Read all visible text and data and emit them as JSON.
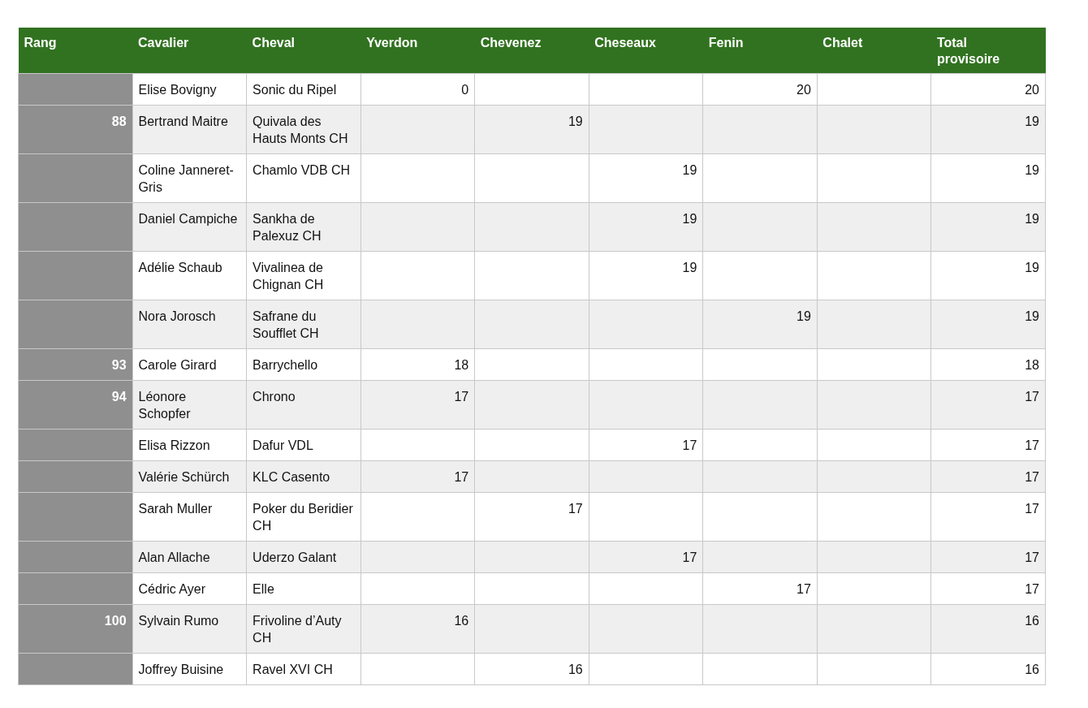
{
  "table": {
    "columns": [
      "Rang",
      "Cavalier",
      "Cheval",
      "Yverdon",
      "Chevenez",
      "Cheseaux",
      "Fenin",
      "Chalet",
      "Total provisoire"
    ],
    "rows": [
      {
        "rider": "Elise Bovigny",
        "horse": "Sonic du Ripel",
        "yverdon": "0",
        "fenin": "20",
        "total": "20"
      },
      {
        "rank": "88",
        "rider": "Bertrand Maitre",
        "horse": "Quivala des Hauts Monts CH",
        "chevenez": "19",
        "total": "19"
      },
      {
        "rider": "Coline Janneret-Gris",
        "horse": "Chamlo VDB CH",
        "cheseaux": "19",
        "total": "19"
      },
      {
        "rider": "Daniel Campiche",
        "horse": "Sankha de Palexuz CH",
        "cheseaux": "19",
        "total": "19"
      },
      {
        "rider": "Adélie Schaub",
        "horse": "Vivalinea de Chignan CH",
        "cheseaux": "19",
        "total": "19"
      },
      {
        "rider": "Nora Jorosch",
        "horse": "Safrane du Soufflet CH",
        "fenin": "19",
        "total": "19"
      },
      {
        "rank": "93",
        "rider": "Carole Girard",
        "horse": "Barrychello",
        "yverdon": "18",
        "total": "18"
      },
      {
        "rank": "94",
        "rider": "Léonore Schopfer",
        "horse": "Chrono",
        "yverdon": "17",
        "total": "17"
      },
      {
        "rider": "Elisa Rizzon",
        "horse": "Dafur VDL",
        "cheseaux": "17",
        "total": "17"
      },
      {
        "rider": "Valérie Schürch",
        "horse": "KLC Casento",
        "yverdon": "17",
        "total": "17"
      },
      {
        "rider": "Sarah Muller",
        "horse": "Poker du Beridier CH",
        "chevenez": "17",
        "total": "17"
      },
      {
        "rider": "Alan Allache",
        "horse": "Uderzo Galant",
        "cheseaux": "17",
        "total": "17"
      },
      {
        "rider": "Cédric Ayer",
        "horse": "Elle",
        "fenin": "17",
        "total": "17"
      },
      {
        "rank": "100",
        "rider": "Sylvain Rumo",
        "horse": "Frivoline d’Auty CH",
        "yverdon": "16",
        "total": "16"
      },
      {
        "rider": "Joffrey Buisine",
        "horse": "Ravel XVI CH",
        "chevenez": "16",
        "total": "16"
      }
    ]
  }
}
